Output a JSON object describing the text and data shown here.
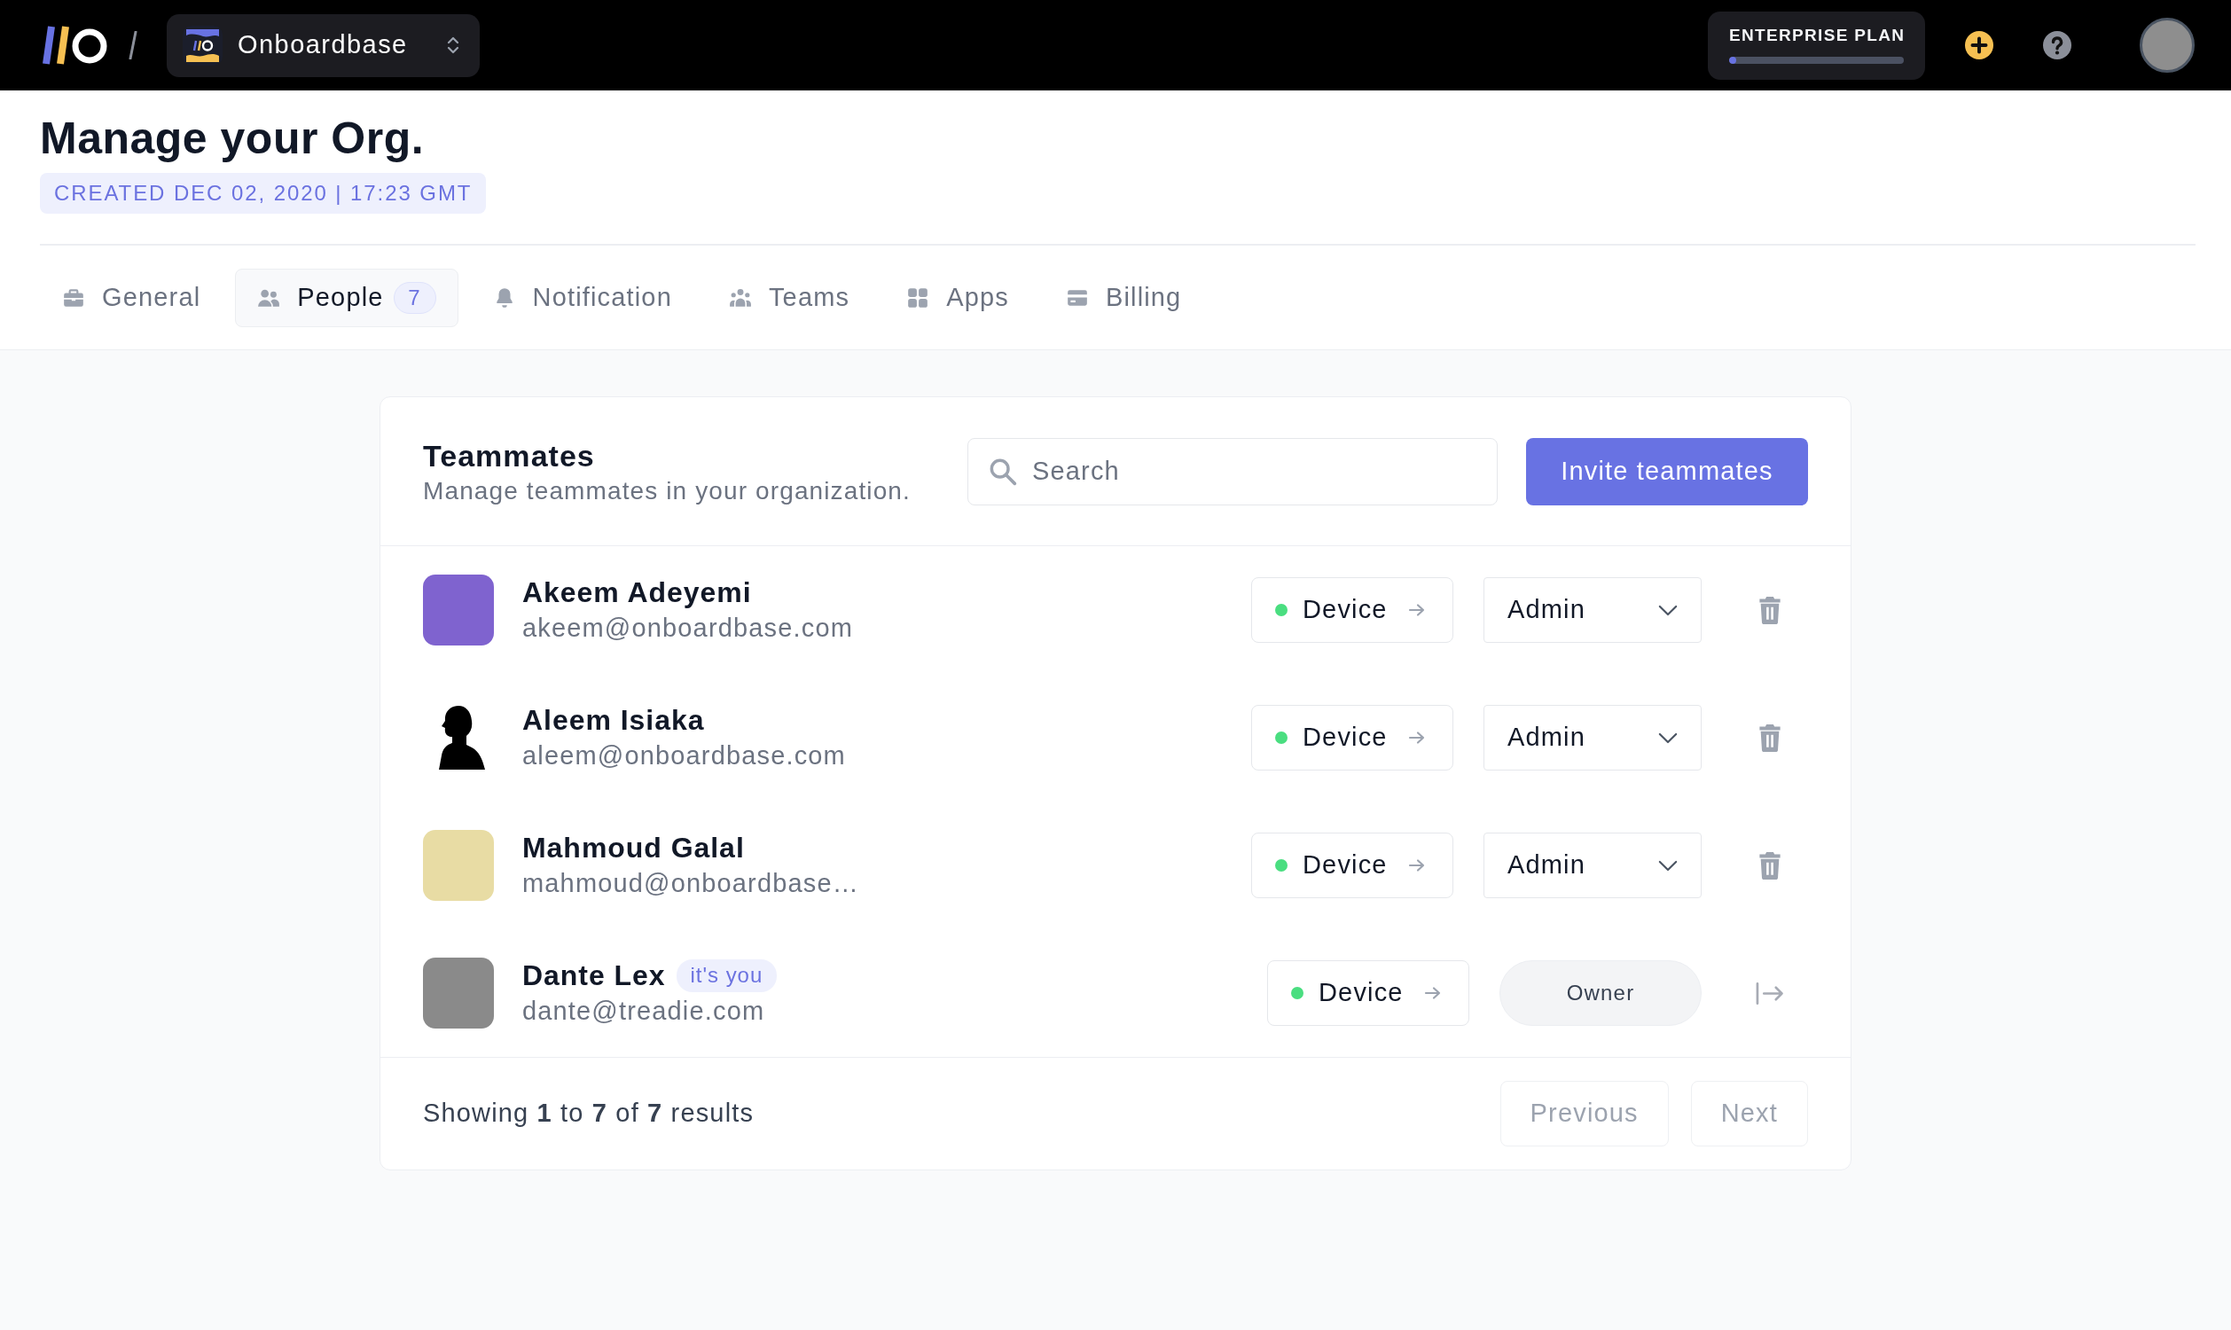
{
  "top_bar": {
    "org_switcher": {
      "name": "Onboardbase"
    },
    "plan": {
      "label": "ENTERPRISE PLAN",
      "level": 0.04
    }
  },
  "header": {
    "title": "Manage your Org.",
    "created": "CREATED DEC 02, 2020 | 17:23 GMT"
  },
  "tabs": [
    {
      "label": "General",
      "selected": false
    },
    {
      "label": "People",
      "count": "7",
      "selected": true
    },
    {
      "label": "Notification",
      "selected": false
    },
    {
      "label": "Teams",
      "selected": false
    },
    {
      "label": "Apps",
      "selected": false
    },
    {
      "label": "Billing",
      "selected": false
    }
  ],
  "teammates": {
    "title": "Teammates",
    "subtitle": "Manage teammates in your organization.",
    "search": {
      "placeholder": "Search"
    },
    "invite_button": "Invite teammates",
    "members": [
      {
        "avatar": {
          "kind": "photo"
        },
        "name": "Akeem Adeyemi",
        "email": "akeem@onboardbase.com",
        "device": "Device",
        "kind": "member",
        "role": "Admin"
      },
      {
        "avatar": {
          "kind": "silhouette"
        },
        "name": "Aleem Isiaka",
        "email": "aleem@onboardbase.com",
        "device": "Device",
        "kind": "member",
        "role": "Admin"
      },
      {
        "avatar": {
          "kind": "photo"
        },
        "name": "Mahmoud Galal",
        "email": "mahmoud@onboardbase…",
        "device": "Device",
        "kind": "member",
        "role": "Admin"
      },
      {
        "avatar": {
          "kind": "photo"
        },
        "name": "Dante Lex",
        "badge": "it's you",
        "email": "dante@treadie.com",
        "device": "Device",
        "kind": "owner",
        "role": "Owner"
      }
    ],
    "footer": {
      "summary": "Showing **1** to **7** of **7** results",
      "buttons": [
        {
          "label": "Previous",
          "disabled": true
        },
        {
          "label": "Next",
          "disabled": true
        }
      ]
    }
  }
}
